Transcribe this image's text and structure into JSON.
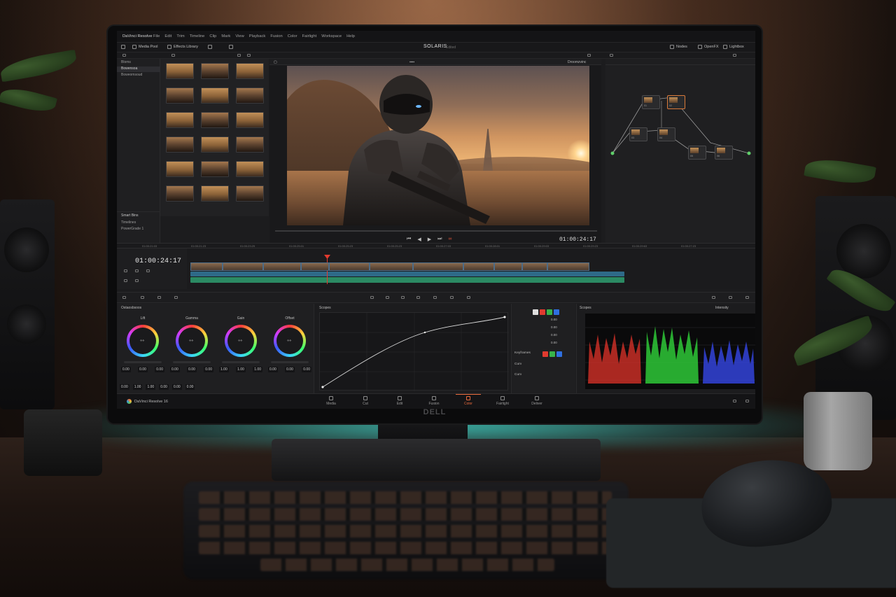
{
  "app": {
    "name": "DaVinci Resolve",
    "project_title": "SOLARIS",
    "project_sub": "Edited",
    "brand": "DELL"
  },
  "menus": [
    "File",
    "Edit",
    "Trim",
    "Timeline",
    "Clip",
    "Mark",
    "View",
    "Playback",
    "Fusion",
    "Color",
    "Fairlight",
    "Workspace",
    "Help"
  ],
  "toolbar": {
    "media_pool": "Media Pool",
    "effects_library": "Effects Library",
    "nodes": "Nodes",
    "openfx": "OpenFX",
    "lightbox": "Lightbox"
  },
  "bins": {
    "items": [
      {
        "label": "Bloms"
      },
      {
        "label": "Bowensoa"
      },
      {
        "label": "Boweomsoud"
      }
    ],
    "smart_bins_title": "Smart Bins",
    "smart_items": [
      "Timelines",
      "PowerGrade 1"
    ]
  },
  "viewer": {
    "timecode": "01:00:24:17",
    "header_right": "Droomzvinc"
  },
  "timeline": {
    "timecode": "01:00:24:17",
    "ruler_ticks": [
      "01:00:21:03",
      "01:00:21:23",
      "01:00:23:29",
      "01:00:25:01",
      "01:00:25:23",
      "01:00:25:23",
      "01:00:27:03",
      "01:00:28:01",
      "01:00:29:03",
      "01:00:29:23",
      "01:00:29:63",
      "01:00:27:23"
    ]
  },
  "color": {
    "wheels_title": "Ostaosbsoos",
    "wheels": [
      {
        "label": "Lift",
        "vals": [
          "0.00",
          "0.00",
          "0.00"
        ]
      },
      {
        "label": "Gamma",
        "vals": [
          "0.00",
          "0.00",
          "0.00"
        ]
      },
      {
        "label": "Gain",
        "vals": [
          "1.00",
          "1.00",
          "1.00"
        ]
      },
      {
        "label": "Offset",
        "vals": [
          "0.00",
          "0.00",
          "0.00"
        ]
      }
    ],
    "wheels_bottom": [
      "0.00",
      "1.00",
      "1.00",
      "0.00",
      "0.00",
      "0.00"
    ],
    "curves_title": "Scopes",
    "scopes_title": "Scopes",
    "scopes_right": "Intensity",
    "curves_side_label": "Keyframes",
    "side_vals": [
      "0.00",
      "0.00",
      "0.00",
      "0.00"
    ],
    "side_rows": [
      "Curv",
      "Curv"
    ]
  },
  "pages": [
    {
      "label": "Media",
      "active": false
    },
    {
      "label": "Cut",
      "active": false
    },
    {
      "label": "Edit",
      "active": false
    },
    {
      "label": "Fusion",
      "active": false
    },
    {
      "label": "Color",
      "active": true
    },
    {
      "label": "Fairlight",
      "active": false
    },
    {
      "label": "Deliver",
      "active": false
    }
  ],
  "footer": {
    "version_label": "DaVinci Resolve 16"
  },
  "colors": {
    "accent": "#e86a3c",
    "playhead": "#e33a2e",
    "audio_blue": "#2f6f8e",
    "audio_green": "#2b8a63",
    "ambient_teal": "#3cdcd2"
  }
}
